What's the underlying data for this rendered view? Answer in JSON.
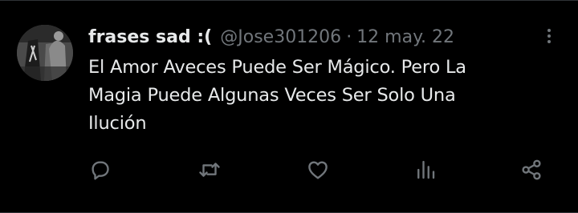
{
  "tweet": {
    "display_name": "frases sad :(",
    "handle": "@Jose301206",
    "separator": "·",
    "date": "12 may. 22",
    "text": "El Amor Aveces Puede Ser Mágico. Pero La\nMagia Puede Algunas Veces Ser Solo Una\nIlución"
  },
  "actions": [
    "reply-icon",
    "retweet-icon",
    "like-icon",
    "views-icon",
    "share-icon"
  ],
  "colors": {
    "background": "#000000",
    "text_primary": "#e7e9ea",
    "text_secondary": "#71767b",
    "border": "#2f3336"
  }
}
